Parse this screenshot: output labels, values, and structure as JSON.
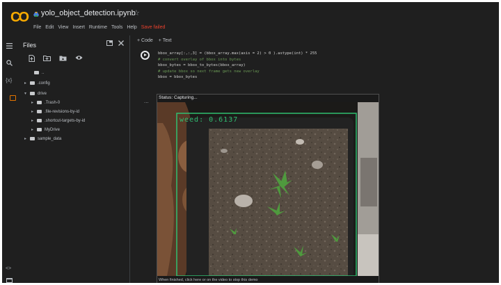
{
  "header": {
    "logo_text": "CO",
    "notebook_title": "yolo_object_detection.ipynb",
    "star_icon": "☆",
    "menu": [
      "File",
      "Edit",
      "View",
      "Insert",
      "Runtime",
      "Tools",
      "Help"
    ],
    "save_status": "Save failed",
    "save_status_color": "#e8412d"
  },
  "rail": {
    "icons": [
      "menu-icon",
      "search-icon",
      "variables-icon",
      "folder-icon"
    ],
    "variables_label": "{x}",
    "bottom_icons": [
      "code-icon",
      "terminal-icon"
    ],
    "code_glyph": "<>"
  },
  "files_panel": {
    "title": "Files",
    "toolbar_icons": [
      "upload-icon",
      "new-folder-icon",
      "mount-drive-icon",
      "hidden-files-icon"
    ],
    "tree": [
      {
        "label": "..",
        "depth": 0,
        "caret": ""
      },
      {
        "label": ".config",
        "depth": 0,
        "caret": "▸"
      },
      {
        "label": "drive",
        "depth": 0,
        "caret": "▾"
      },
      {
        "label": ".Trash-0",
        "depth": 1,
        "caret": "▸"
      },
      {
        "label": ".file-revisions-by-id",
        "depth": 1,
        "caret": "▸"
      },
      {
        "label": ".shortcut-targets-by-id",
        "depth": 1,
        "caret": "▸"
      },
      {
        "label": "MyDrive",
        "depth": 1,
        "caret": "▸"
      },
      {
        "label": "sample_data",
        "depth": 0,
        "caret": "▸"
      }
    ]
  },
  "toolbar": {
    "code_label": "+ Code",
    "text_label": "+ Text"
  },
  "code_cell": {
    "lines": [
      {
        "text": "bbox_array[:,:,3] = (bbox_array.max(axis = 2) > 0 ).astype(int) * 255",
        "kind": "code"
      },
      {
        "text": "# convert overlay of bbox into bytes",
        "kind": "comment"
      },
      {
        "text": "bbox_bytes = bbox_to_bytes(bbox_array)",
        "kind": "code"
      },
      {
        "text": "# update bbox so next frame gets new overlay",
        "kind": "comment"
      },
      {
        "text": "bbox = bbox_bytes",
        "kind": "code"
      }
    ]
  },
  "output": {
    "ellipsis": "...",
    "status": "Status: Capturing...",
    "detection_label": "weed: 0.6137",
    "detection_color": "#2fbf71",
    "caption": "When finished, click here or on the video to stop this demo"
  }
}
